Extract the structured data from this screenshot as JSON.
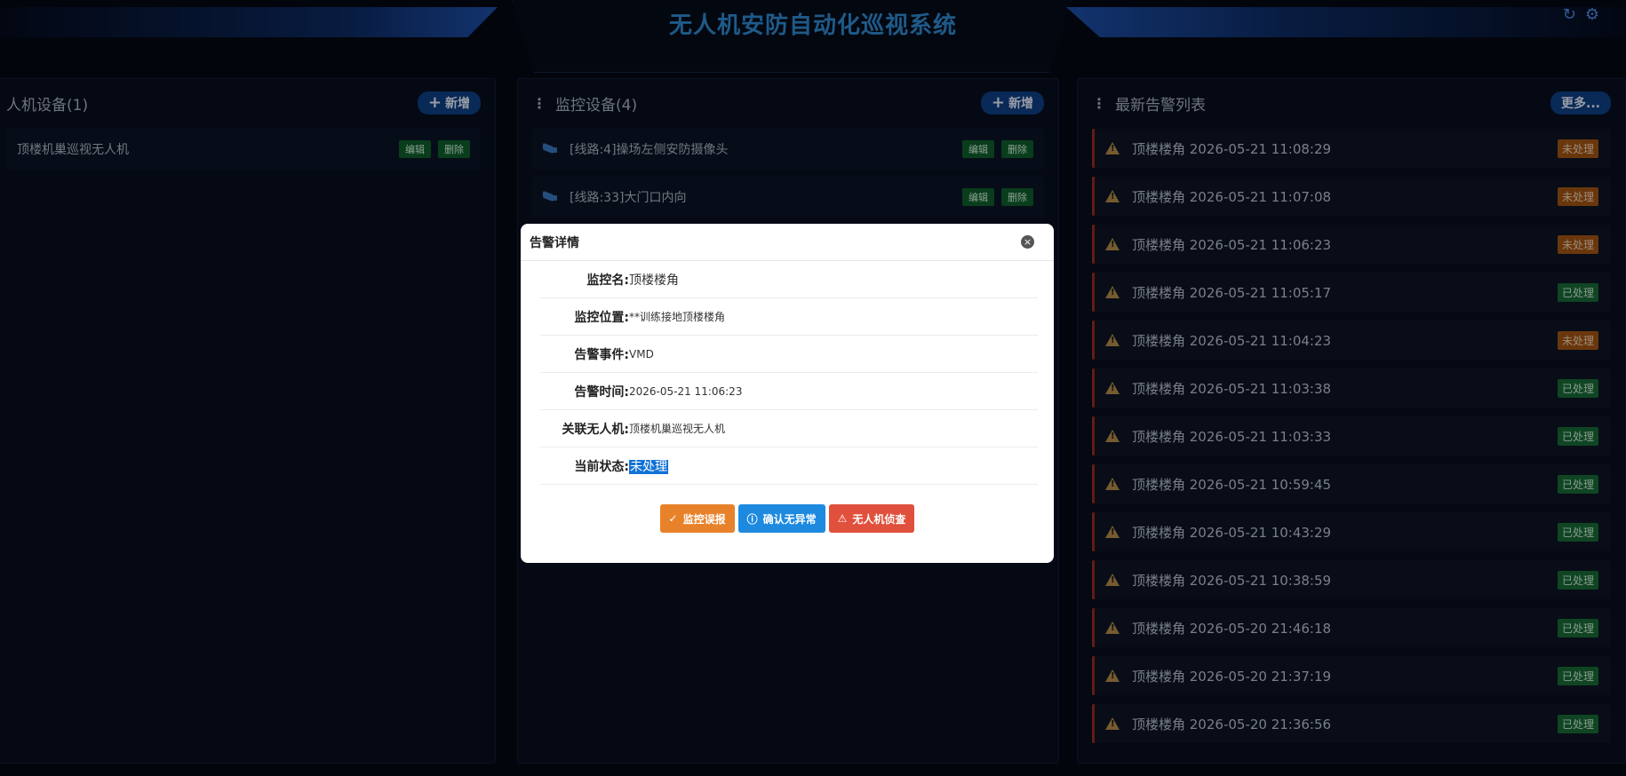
{
  "header": {
    "title": "无人机安防自动化巡视系统",
    "refresh_icon": "↻",
    "settings_icon": "⚙"
  },
  "drone_panel": {
    "title": "人机设备(1)",
    "add_label": "新增",
    "items": [
      {
        "name": "顶楼机巢巡视无人机",
        "edit": "编辑",
        "delete": "删除"
      }
    ]
  },
  "monitor_panel": {
    "title": "监控设备(4)",
    "add_label": "新增",
    "items": [
      {
        "name": "[线路:4]操场左侧安防摄像头",
        "edit": "编辑",
        "delete": "删除"
      },
      {
        "name": "[线路:33]大门口内向",
        "edit": "编辑",
        "delete": "删除"
      }
    ]
  },
  "alarm_panel": {
    "title": "最新告警列表",
    "more_label": "更多...",
    "items": [
      {
        "text": "顶楼楼角 2026-05-21 11:08:29",
        "status": "未处理",
        "handled": false
      },
      {
        "text": "顶楼楼角 2026-05-21 11:07:08",
        "status": "未处理",
        "handled": false
      },
      {
        "text": "顶楼楼角 2026-05-21 11:06:23",
        "status": "未处理",
        "handled": false
      },
      {
        "text": "顶楼楼角 2026-05-21 11:05:17",
        "status": "已处理",
        "handled": true
      },
      {
        "text": "顶楼楼角 2026-05-21 11:04:23",
        "status": "未处理",
        "handled": false
      },
      {
        "text": "顶楼楼角 2026-05-21 11:03:38",
        "status": "已处理",
        "handled": true
      },
      {
        "text": "顶楼楼角 2026-05-21 11:03:33",
        "status": "已处理",
        "handled": true
      },
      {
        "text": "顶楼楼角 2026-05-21 10:59:45",
        "status": "已处理",
        "handled": true
      },
      {
        "text": "顶楼楼角 2026-05-21 10:43:29",
        "status": "已处理",
        "handled": true
      },
      {
        "text": "顶楼楼角 2026-05-21 10:38:59",
        "status": "已处理",
        "handled": true
      },
      {
        "text": "顶楼楼角 2026-05-20 21:46:18",
        "status": "已处理",
        "handled": true
      },
      {
        "text": "顶楼楼角 2026-05-20 21:37:19",
        "status": "已处理",
        "handled": true
      },
      {
        "text": "顶楼楼角 2026-05-20 21:36:56",
        "status": "已处理",
        "handled": true
      }
    ]
  },
  "modal": {
    "title": "告警详情",
    "close_icon": "×",
    "fields": [
      {
        "label": "监控名:",
        "value": "顶楼楼角"
      },
      {
        "label": "监控位置:",
        "value": "**训练接地顶楼楼角"
      },
      {
        "label": "告警事件:",
        "value": "VMD"
      },
      {
        "label": "告警时间:",
        "value": "2026-05-21 11:06:23"
      },
      {
        "label": "关联无人机:",
        "value": "顶楼机巢巡视无人机"
      },
      {
        "label": "当前状态:",
        "value": "未处理"
      }
    ],
    "actions": {
      "false_alarm": "监控误报",
      "confirm_normal": "确认无异常",
      "drone_investigate": "无人机侦查"
    }
  },
  "colors": {
    "accent": "#2e8ad3",
    "pending": "#a45514",
    "done": "#1a6a36"
  }
}
